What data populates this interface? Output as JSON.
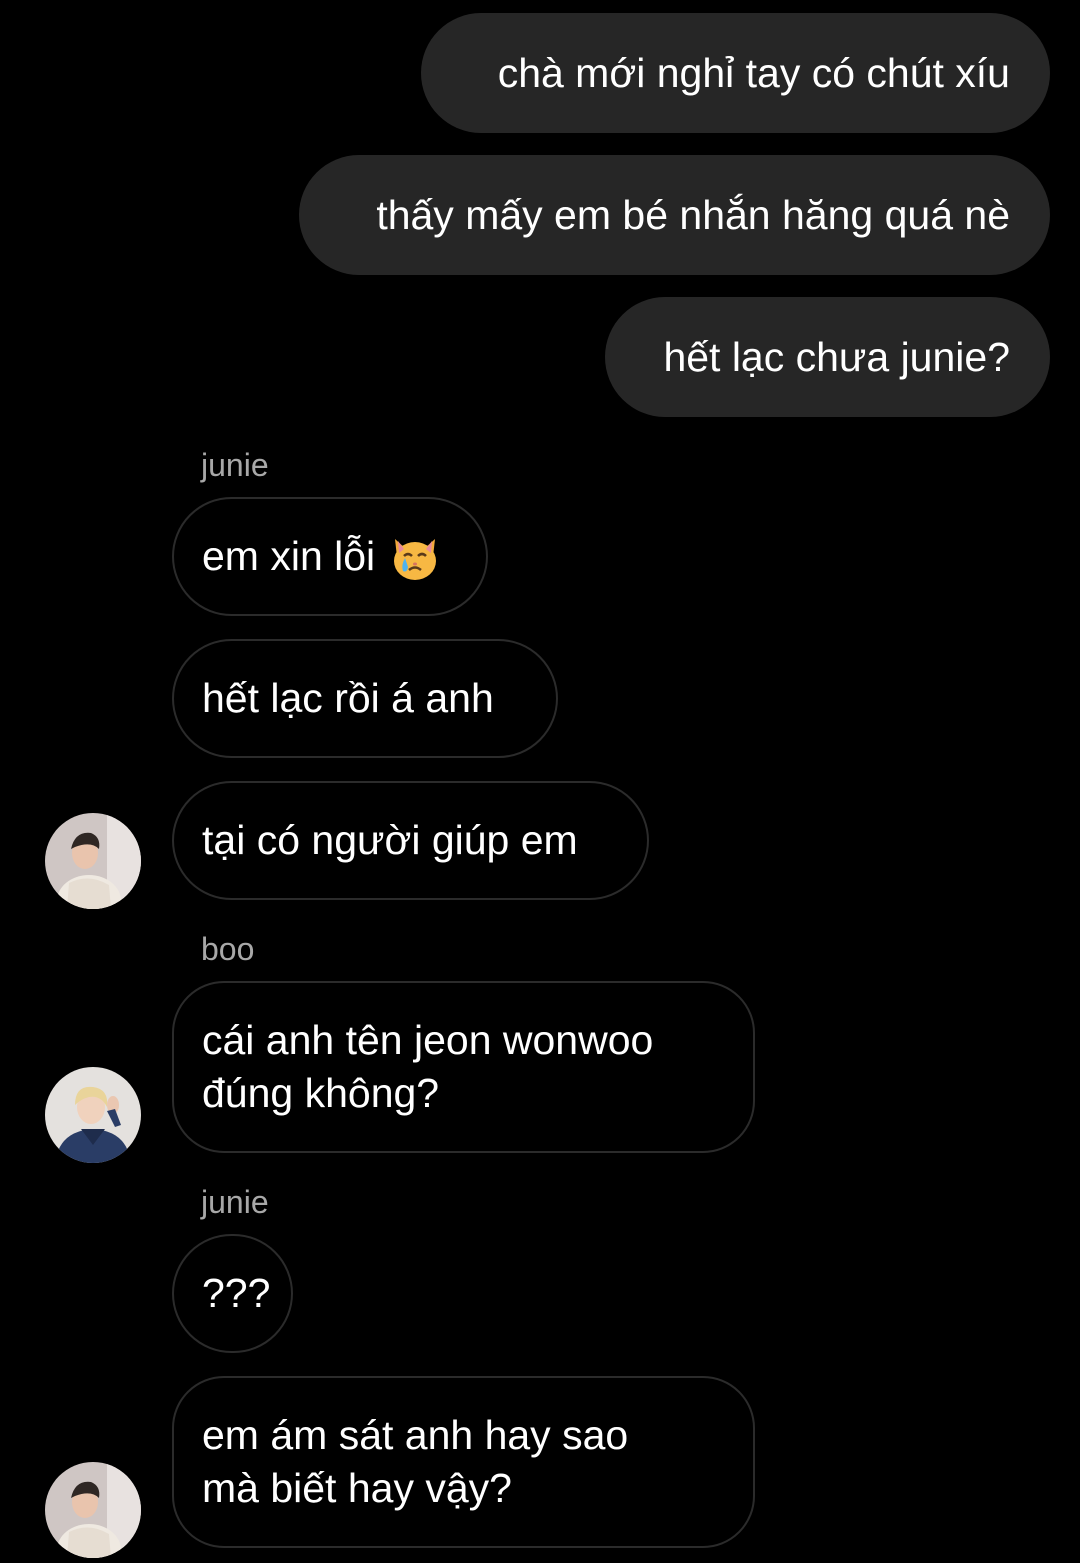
{
  "outgoing": [
    {
      "text": "chà mới nghỉ tay có chút xíu"
    },
    {
      "text": "thấy mấy em bé nhắn hăng quá nè"
    },
    {
      "text": "hết lạc chưa junie?"
    }
  ],
  "groups": [
    {
      "sender": "junie",
      "messages": [
        {
          "text": "em xin lỗi",
          "icon": "crying-cat-icon"
        },
        {
          "text": "hết lạc rồi á anh"
        },
        {
          "text": "tại có người giúp em"
        }
      ]
    },
    {
      "sender": "boo",
      "messages": [
        {
          "line1": "cái anh tên jeon wonwoo",
          "line2": "đúng không?"
        }
      ]
    },
    {
      "sender": "junie",
      "messages": [
        {
          "text": "???"
        },
        {
          "line1": "em ám sát anh hay sao",
          "line2": "mà biết hay vậy?"
        }
      ]
    }
  ],
  "colors": {
    "background": "#000000",
    "outgoing_bubble": "#262626",
    "incoming_border": "#2b2b2b",
    "sender_label": "#a8a8a8",
    "text": "#ffffff"
  }
}
